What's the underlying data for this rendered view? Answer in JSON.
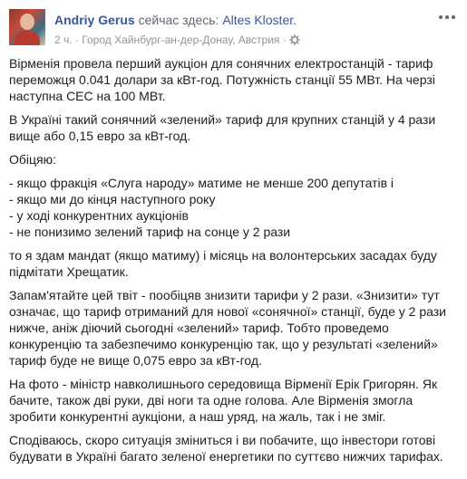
{
  "post": {
    "author": "Andriy Gerus",
    "status": "сейчас здесь:",
    "location": "Altes Kloster.",
    "time": "2 ч.",
    "separator": "·",
    "place": "Город Хайнбург-ан-дер-Донау, Австрия",
    "privacy_icon": "gear-icon",
    "menu_icon": "more-options-icon"
  },
  "body": {
    "p1": "Вірменія провела перший аукціон для сонячних електростанцій - тариф переможця 0.041 долари за кВт-год. Потужність станції 55 МВт. На черзі наступна СЕС на 100 МВт.",
    "p2": "В Україні такий сонячний «зелений» тариф для крупних станцій у 4 рази вище або 0,15 евро за кВт-год.",
    "p3": "Обіцяю:",
    "promises": [
      "- якщо фракція «Слуга народу» матиме не менше 200 депутатів і",
      "- якщо ми до кінця наступного року",
      "- у ході конкурентних аукціонів",
      "- не понизимо зелений тариф на сонце у 2 рази"
    ],
    "p4": "то я здам мандат (якщо матиму) і місяць на волонтерських засадах буду підмітати Хрещатик.",
    "p5": "Запам'ятайте цей твіт - пообіцяв знизити тарифи у 2 рази. «Знизити» тут означає, що тариф отриманий для нової «сонячної» станції, буде у 2 рази нижче, аніж діючий сьогодні «зелений» тариф. Тобто проведемо конкуренцію та забезпечимо конкуренцію так, що у результаті «зелений» тариф буде не вище 0,075 евро за кВт-год.",
    "p6": "На фото - міністр навколишнього середовища Вірменії Ерік Григорян. Як бачите, також дві руки, дві ноги та одне голова. Але Вірменія змогла зробити конкурентні аукціони, а наш уряд, на жаль, так і не зміг.",
    "p7": "Сподіваюсь, скоро ситуація зміниться і ви побачите, що інвестори готові будувати в Україні багато зеленої енергетики по суттєво нижчих тарифах."
  }
}
